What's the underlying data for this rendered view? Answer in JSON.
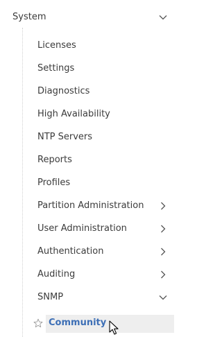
{
  "nav": {
    "section": {
      "label": "System",
      "expanded": true
    },
    "items": [
      {
        "label": "Licenses",
        "has_children": false
      },
      {
        "label": "Settings",
        "has_children": false
      },
      {
        "label": "Diagnostics",
        "has_children": false
      },
      {
        "label": "High Availability",
        "has_children": false
      },
      {
        "label": "NTP Servers",
        "has_children": false
      },
      {
        "label": "Reports",
        "has_children": false
      },
      {
        "label": "Profiles",
        "has_children": false
      },
      {
        "label": "Partition Administration",
        "has_children": true,
        "expanded": false
      },
      {
        "label": "User Administration",
        "has_children": true,
        "expanded": false
      },
      {
        "label": "Authentication",
        "has_children": true,
        "expanded": false
      },
      {
        "label": "Auditing",
        "has_children": true,
        "expanded": false
      },
      {
        "label": "SNMP",
        "has_children": true,
        "expanded": true
      }
    ],
    "subitems": [
      {
        "label": "Community",
        "selected": true,
        "favorite": false
      }
    ]
  },
  "icons": {
    "expanded": "chevron-down-icon",
    "collapsed": "chevron-right-icon",
    "favorite": "star-outline-icon",
    "pointer": "mouse-cursor-icon"
  },
  "colors": {
    "text": "#3b3b3b",
    "selected_text": "#3d6fb6",
    "selected_bg": "#eeeeee",
    "chevron": "#555555"
  }
}
